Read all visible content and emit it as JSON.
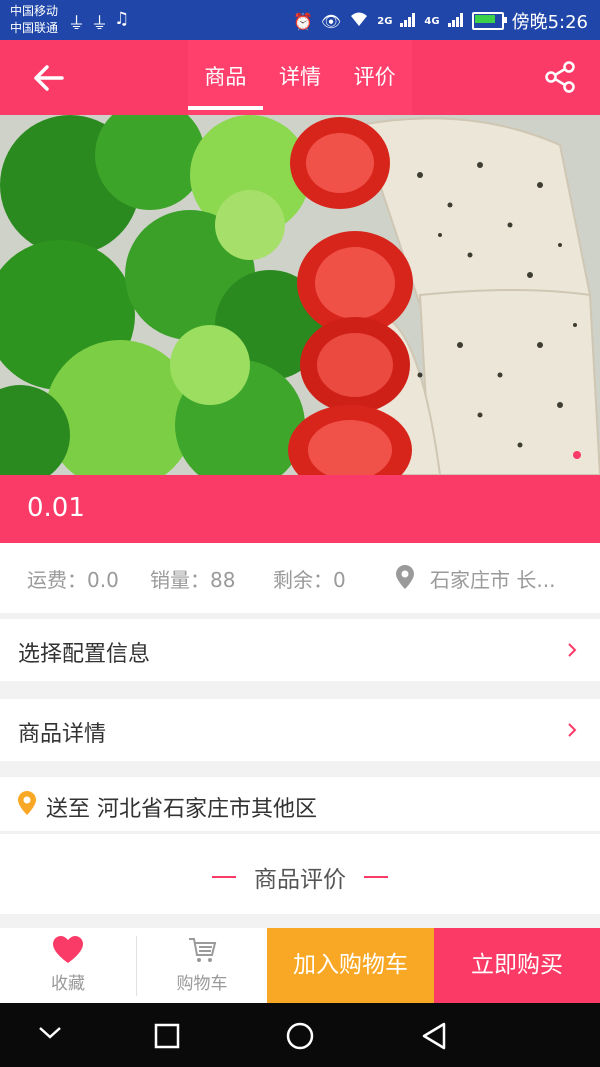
{
  "status_bar": {
    "carrier_1": "中国移动",
    "carrier_2": "中国联通",
    "net_1": "2G",
    "net_2": "4G",
    "time": "傍晚5:26"
  },
  "header": {
    "tabs": [
      {
        "label": "商品",
        "active": true
      },
      {
        "label": "详情",
        "active": false
      },
      {
        "label": "评价",
        "active": false
      }
    ]
  },
  "product": {
    "price": "0.01",
    "freight": "运费：0.0",
    "sales": "销量：88",
    "remaining": "剩余：0",
    "location": "石家庄市 长..."
  },
  "rows": {
    "config": "选择配置信息",
    "details": "商品详情",
    "delivery": "送至  河北省石家庄市其他区"
  },
  "reviews": {
    "title": "商品评价"
  },
  "bottom_bar": {
    "favorite": "收藏",
    "cart": "购物车",
    "add_to_cart": "加入购物车",
    "buy_now": "立即购买"
  },
  "colors": {
    "brand_pink": "#fa3b67",
    "status_blue": "#1f46a8",
    "add_cart_orange": "#f9a825",
    "buy_pink": "#fb3b65"
  },
  "icons": [
    "back-arrow-icon",
    "share-icon",
    "location-pin-icon",
    "chevron-right-icon",
    "heart-icon",
    "cart-icon",
    "nav-back-icon",
    "nav-home-icon",
    "nav-recents-icon"
  ]
}
